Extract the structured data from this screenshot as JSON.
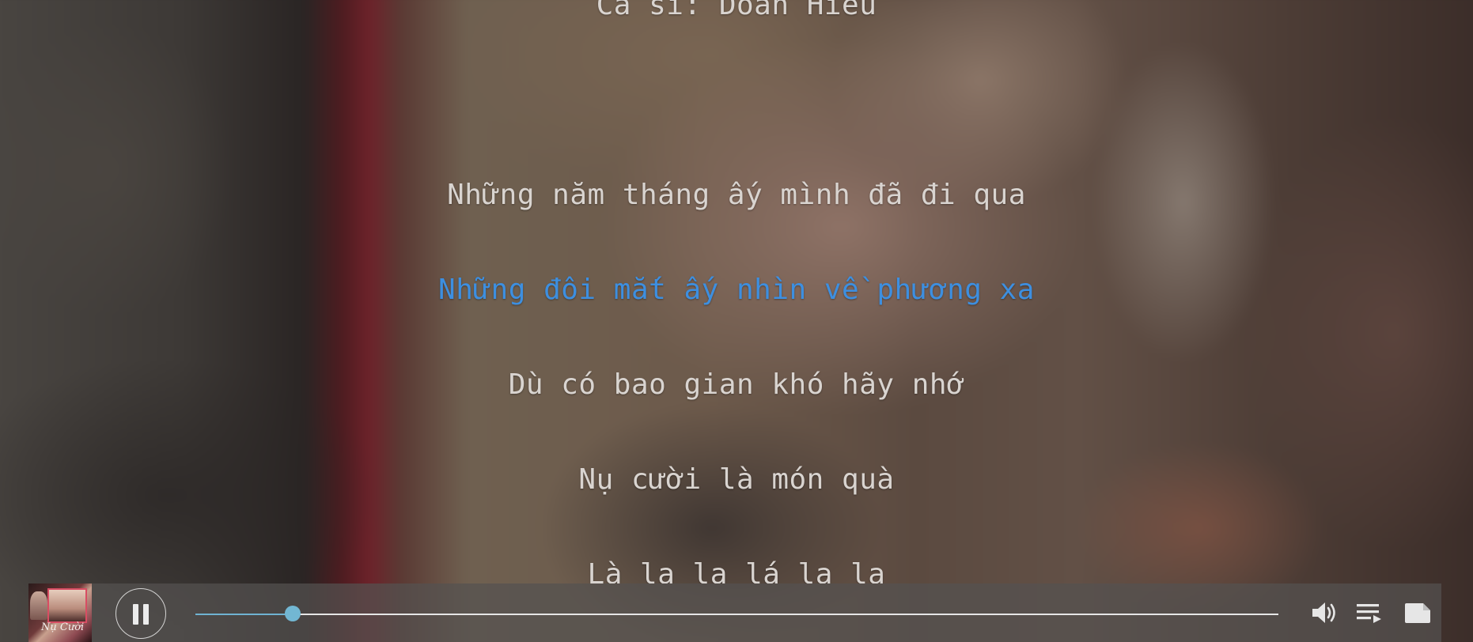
{
  "lyrics": {
    "singer": "Ca sĩ: Doãn Hiếu",
    "lines": [
      "Những năm tháng ấy mình đã đi qua",
      "Những đôi mắt ấy nhìn về phương xa",
      "Dù có bao gian khó hãy nhớ",
      "Nụ cười là món quà",
      "Là la la lá la la"
    ],
    "active_index": 1
  },
  "player": {
    "album_art_text": "Nụ Cười",
    "progress": 0.09,
    "state": "playing",
    "icons": {
      "play_pause": "pause-icon",
      "volume": "volume-icon",
      "playlist": "playlist-icon",
      "lyrics_toggle": "note-icon"
    }
  },
  "colors": {
    "active_lyric": "#3d8fe0",
    "lyric": "#d9d4d0",
    "progress_accent": "#72b7d3"
  }
}
